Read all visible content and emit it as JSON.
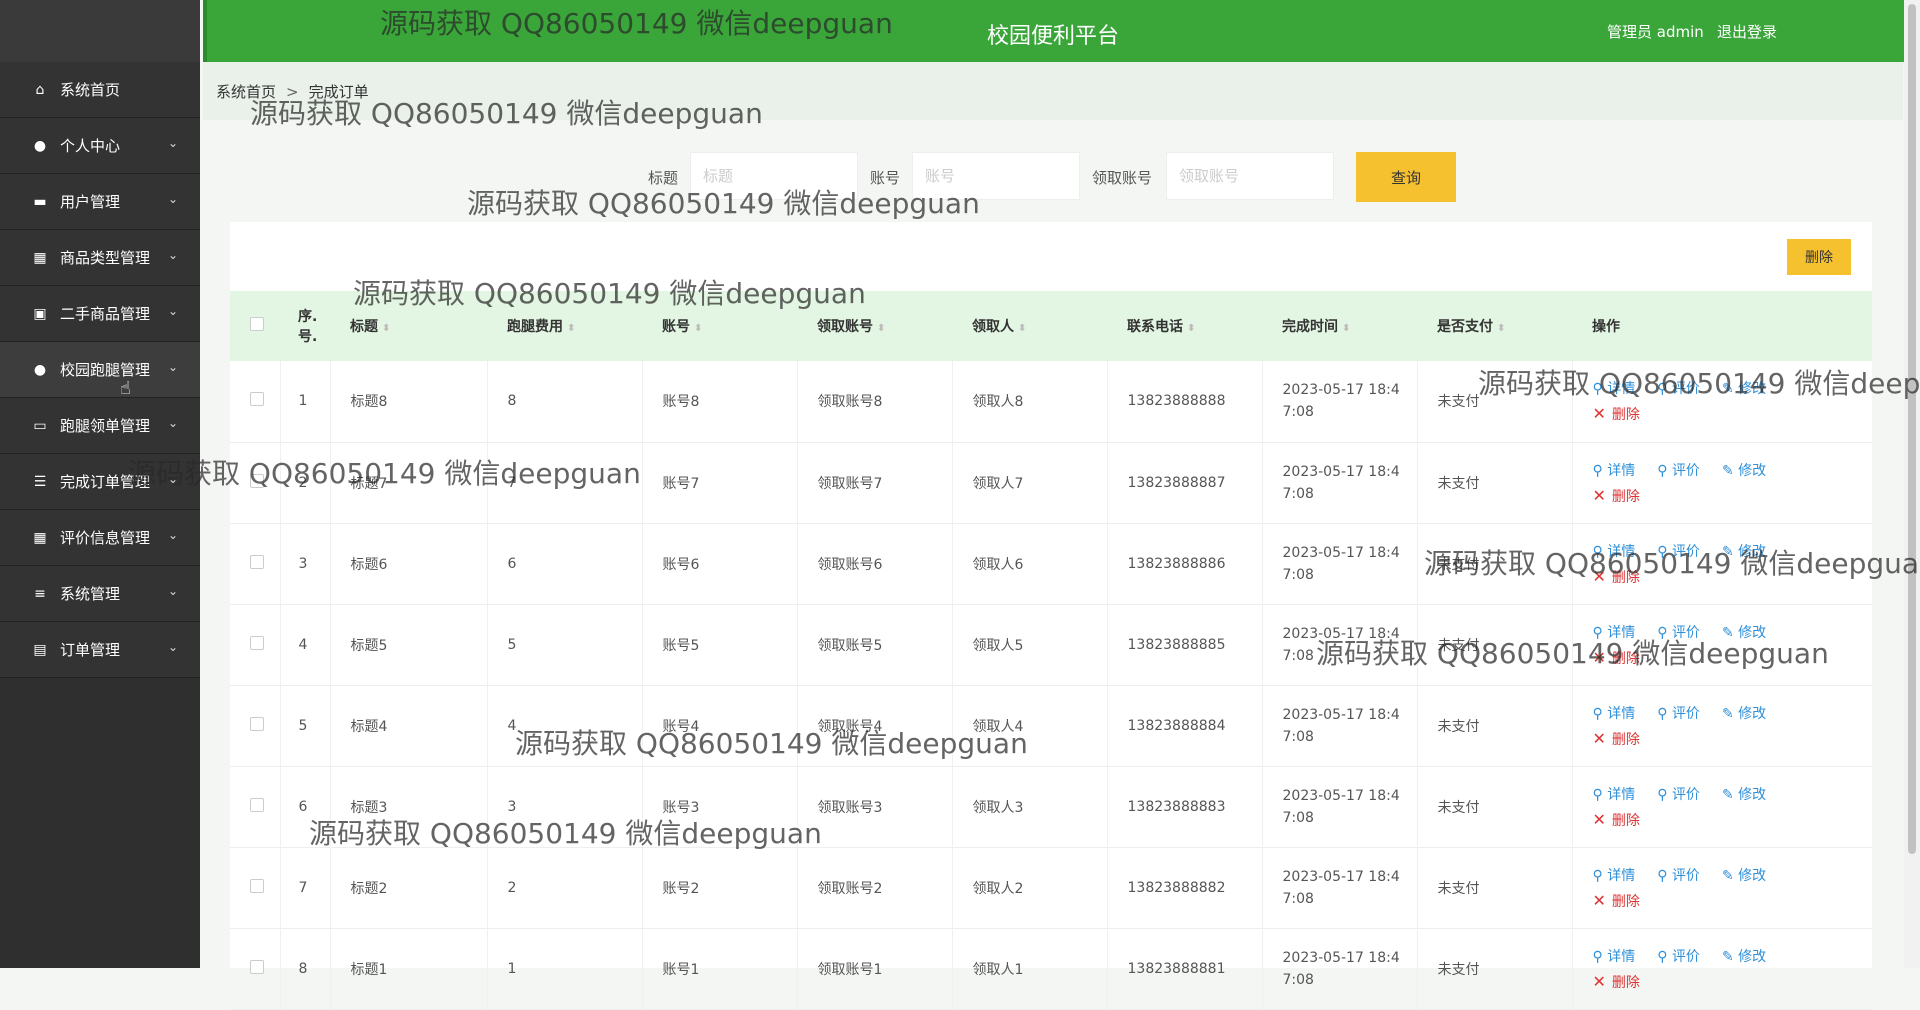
{
  "header": {
    "title": "校园便利平台",
    "user": "管理员 admin",
    "logout": "退出登录"
  },
  "sidebar": {
    "items": [
      {
        "label": "系统首页",
        "icon": "home-icon"
      },
      {
        "label": "个人中心",
        "icon": "person-icon"
      },
      {
        "label": "用户管理",
        "icon": "users-icon"
      },
      {
        "label": "商品类型管理",
        "icon": "grid-icon"
      },
      {
        "label": "二手商品管理",
        "icon": "briefcase-icon"
      },
      {
        "label": "校园跑腿管理",
        "icon": "person-icon"
      },
      {
        "label": "跑腿领单管理",
        "icon": "monitor-icon"
      },
      {
        "label": "完成订单管理",
        "icon": "sliders-icon"
      },
      {
        "label": "评价信息管理",
        "icon": "grid-icon"
      },
      {
        "label": "系统管理",
        "icon": "list-icon"
      },
      {
        "label": "订单管理",
        "icon": "clipboard-icon"
      }
    ]
  },
  "breadcrumb": {
    "home": "系统首页",
    "separator": ">",
    "current": "完成订单"
  },
  "search": {
    "title_label": "标题",
    "title_placeholder": "标题",
    "account_label": "账号",
    "account_placeholder": "账号",
    "receiver_label": "领取账号",
    "receiver_placeholder": "领取账号",
    "query_button": "查询"
  },
  "toolbar": {
    "delete_button": "删除"
  },
  "table": {
    "headers": [
      "序.号.",
      "标题",
      "跑腿费用",
      "账号",
      "领取账号",
      "领取人",
      "联系电话",
      "完成时间",
      "是否支付",
      "操作"
    ],
    "actions": {
      "detail": "详情",
      "rate": "评价",
      "edit": "修改",
      "delete": "删除"
    },
    "rows": [
      {
        "no": "1",
        "title": "标题8",
        "fee": "8",
        "account": "账号8",
        "recv_account": "领取账号8",
        "receiver": "领取人8",
        "phone": "13823888888",
        "time1": "2023-05-17 18:4",
        "time2": "7:08",
        "paid": "未支付"
      },
      {
        "no": "2",
        "title": "标题7",
        "fee": "7",
        "account": "账号7",
        "recv_account": "领取账号7",
        "receiver": "领取人7",
        "phone": "13823888887",
        "time1": "2023-05-17 18:4",
        "time2": "7:08",
        "paid": "未支付"
      },
      {
        "no": "3",
        "title": "标题6",
        "fee": "6",
        "account": "账号6",
        "recv_account": "领取账号6",
        "receiver": "领取人6",
        "phone": "13823888886",
        "time1": "2023-05-17 18:4",
        "time2": "7:08",
        "paid": "未支付"
      },
      {
        "no": "4",
        "title": "标题5",
        "fee": "5",
        "account": "账号5",
        "recv_account": "领取账号5",
        "receiver": "领取人5",
        "phone": "13823888885",
        "time1": "2023-05-17 18:4",
        "time2": "7:08",
        "paid": "未支付"
      },
      {
        "no": "5",
        "title": "标题4",
        "fee": "4",
        "account": "账号4",
        "recv_account": "领取账号4",
        "receiver": "领取人4",
        "phone": "13823888884",
        "time1": "2023-05-17 18:4",
        "time2": "7:08",
        "paid": "未支付"
      },
      {
        "no": "6",
        "title": "标题3",
        "fee": "3",
        "account": "账号3",
        "recv_account": "领取账号3",
        "receiver": "领取人3",
        "phone": "13823888883",
        "time1": "2023-05-17 18:4",
        "time2": "7:08",
        "paid": "未支付"
      },
      {
        "no": "7",
        "title": "标题2",
        "fee": "2",
        "account": "账号2",
        "recv_account": "领取账号2",
        "receiver": "领取人2",
        "phone": "13823888882",
        "time1": "2023-05-17 18:4",
        "time2": "7:08",
        "paid": "未支付"
      },
      {
        "no": "8",
        "title": "标题1",
        "fee": "1",
        "account": "账号1",
        "recv_account": "领取账号1",
        "receiver": "领取人1",
        "phone": "13823888881",
        "time1": "2023-05-17 18:4",
        "time2": "7:08",
        "paid": "未支付"
      }
    ]
  },
  "watermark": "源码获取 QQ86050149 微信deepguan",
  "colors": {
    "header_green": "#3aa63a",
    "sidebar": "#2f2f2f",
    "accent_yellow": "#f6c12e",
    "link_blue": "#2f8fd8",
    "delete_red": "#d33333"
  }
}
